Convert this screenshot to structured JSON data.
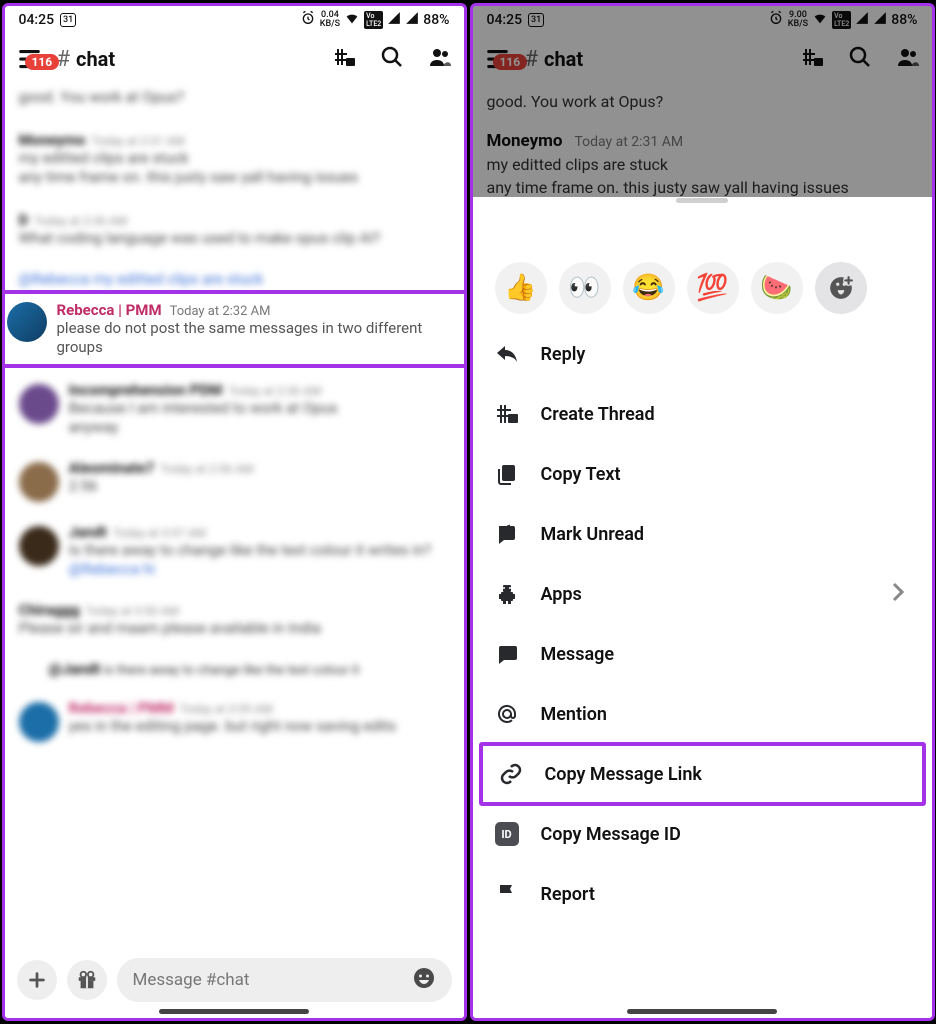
{
  "status": {
    "time": "04:25",
    "date_icon": "31",
    "net_speed_left": "0.04",
    "net_speed_right": "9.00",
    "net_unit": "KB/S",
    "lte_label": "LTE 2",
    "battery": "88%"
  },
  "navbar": {
    "badge": "116",
    "hash": "#",
    "title": "chat"
  },
  "pane1": {
    "highlight": {
      "author": "Rebecca | PMM",
      "time": "Today at 2:32 AM",
      "body": "please do not post the same messages in two different groups"
    }
  },
  "pane2": {
    "line0": "good. You work at Opus?",
    "author": "Moneymo",
    "time": "Today at 2:31 AM",
    "line1": "my editted clips are stuck",
    "line2": "any time frame on. this justy saw yall having issues"
  },
  "emojis": [
    "👍",
    "👀",
    "😂",
    "💯",
    "🍉"
  ],
  "menu": {
    "reply": "Reply",
    "create_thread": "Create Thread",
    "copy_text": "Copy Text",
    "mark_unread": "Mark Unread",
    "apps": "Apps",
    "message": "Message",
    "mention": "Mention",
    "copy_link": "Copy Message Link",
    "copy_id": "Copy Message ID",
    "id_badge": "ID",
    "report": "Report"
  },
  "composer": {
    "placeholder": "Message #chat"
  }
}
